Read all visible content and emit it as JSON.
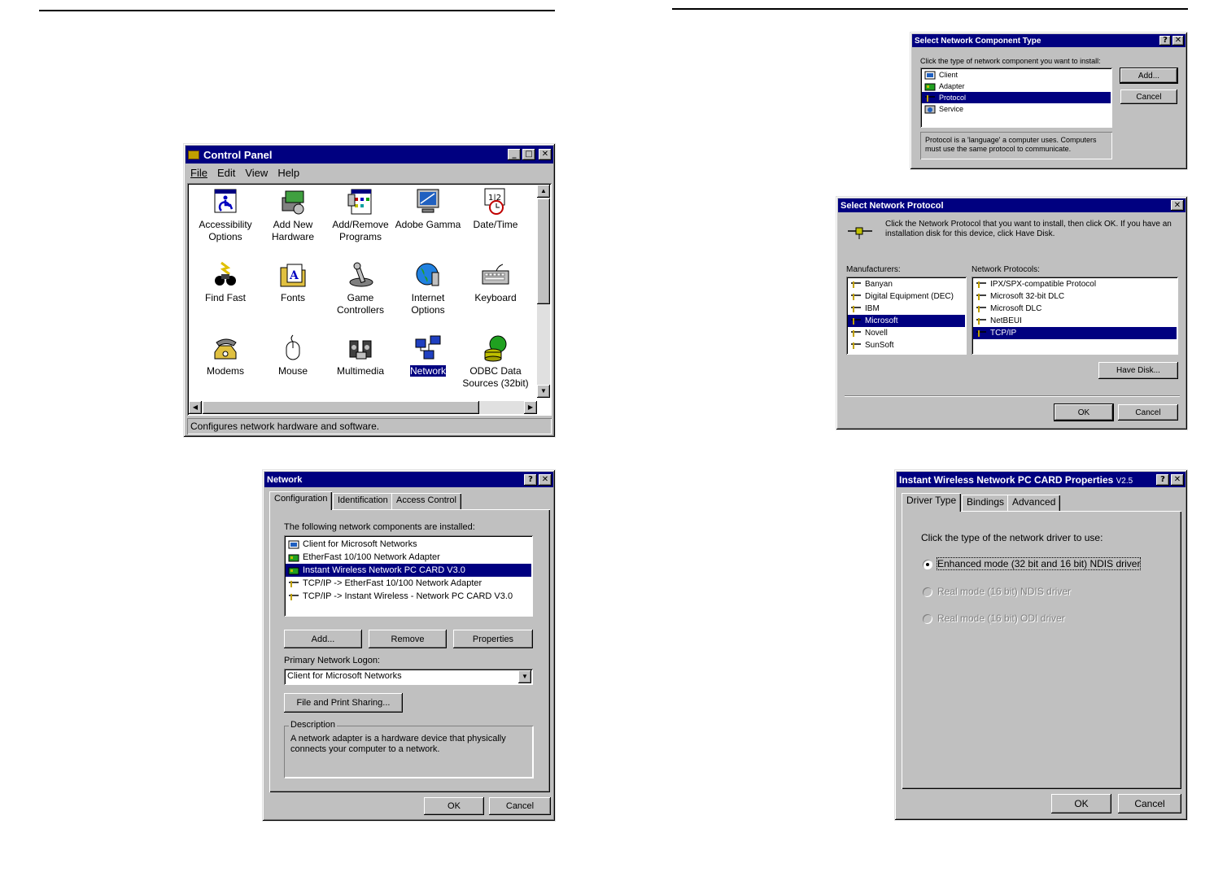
{
  "control_panel": {
    "title": "Control Panel",
    "menu": [
      "File",
      "Edit",
      "View",
      "Help"
    ],
    "items": [
      {
        "label": "Accessibility Options",
        "icon": "accessibility-icon"
      },
      {
        "label": "Add New Hardware",
        "icon": "add-hardware-icon"
      },
      {
        "label": "Add/Remove Programs",
        "icon": "add-remove-programs-icon"
      },
      {
        "label": "Adobe Gamma",
        "icon": "monitor-icon"
      },
      {
        "label": "Date/Time",
        "icon": "calendar-clock-icon"
      },
      {
        "label": "Find Fast",
        "icon": "binoculars-icon"
      },
      {
        "label": "Fonts",
        "icon": "fonts-folder-icon"
      },
      {
        "label": "Game Controllers",
        "icon": "joystick-icon"
      },
      {
        "label": "Internet Options",
        "icon": "globe-icon"
      },
      {
        "label": "Keyboard",
        "icon": "keyboard-icon"
      },
      {
        "label": "Modems",
        "icon": "phone-icon"
      },
      {
        "label": "Mouse",
        "icon": "mouse-icon"
      },
      {
        "label": "Multimedia",
        "icon": "speakers-icon"
      },
      {
        "label": "Network",
        "icon": "network-icon"
      },
      {
        "label": "ODBC Data Sources (32bit)",
        "icon": "database-icon"
      }
    ],
    "selected": "Network",
    "status": "Configures network hardware and software."
  },
  "component_type": {
    "title": "Select Network Component Type",
    "prompt": "Click the type of network component you want to install:",
    "items": [
      "Client",
      "Adapter",
      "Protocol",
      "Service"
    ],
    "selected": "Protocol",
    "add_label": "Add...",
    "cancel_label": "Cancel",
    "description": "Protocol is a 'language' a computer uses. Computers must use the same protocol to communicate."
  },
  "protocol_dialog": {
    "title": "Select Network Protocol",
    "instructions": "Click the Network Protocol that you want to install, then click OK. If you have an installation disk for this device, click Have Disk.",
    "manufacturers_label": "Manufacturers:",
    "manufacturers": [
      "Banyan",
      "Digital Equipment (DEC)",
      "IBM",
      "Microsoft",
      "Novell",
      "SunSoft"
    ],
    "manufacturer_selected": "Microsoft",
    "protocols_label": "Network Protocols:",
    "protocols": [
      "IPX/SPX-compatible Protocol",
      "Microsoft 32-bit DLC",
      "Microsoft DLC",
      "NetBEUI",
      "TCP/IP"
    ],
    "protocol_selected": "TCP/IP",
    "have_disk_label": "Have Disk...",
    "ok_label": "OK",
    "cancel_label": "Cancel"
  },
  "network_dialog": {
    "title": "Network",
    "tabs": [
      "Configuration",
      "Identification",
      "Access Control"
    ],
    "components_label": "The following network components are installed:",
    "components": [
      {
        "label": "Client for Microsoft Networks",
        "icon": "client-icon"
      },
      {
        "label": "EtherFast 10/100 Network Adapter",
        "icon": "adapter-icon"
      },
      {
        "label": "Instant Wireless Network PC CARD V3.0",
        "icon": "adapter-icon"
      },
      {
        "label": "TCP/IP -> EtherFast 10/100 Network Adapter",
        "icon": "protocol-icon"
      },
      {
        "label": "TCP/IP -> Instant Wireless - Network PC CARD V3.0",
        "icon": "protocol-icon"
      }
    ],
    "selected_index": 2,
    "add_label": "Add...",
    "remove_label": "Remove",
    "properties_label": "Properties",
    "logon_label": "Primary Network Logon:",
    "logon_value": "Client for Microsoft Networks",
    "sharing_label": "File and Print Sharing...",
    "description_label": "Description",
    "description_text": "A network adapter is a hardware device that physically connects your computer to a network.",
    "ok_label": "OK",
    "cancel_label": "Cancel"
  },
  "pc_card_dialog": {
    "title": "Instant Wireless Network PC CARD Properties",
    "title_version": "V2.5",
    "tabs": [
      "Driver Type",
      "Bindings",
      "Advanced"
    ],
    "prompt": "Click the type of the network driver to use:",
    "options": [
      {
        "label": "Enhanced mode (32 bit and 16 bit) NDIS driver",
        "checked": true,
        "enabled": true
      },
      {
        "label": "Real mode (16 bit) NDIS driver",
        "checked": false,
        "enabled": false
      },
      {
        "label": "Real mode (16 bit) ODI driver",
        "checked": false,
        "enabled": false
      }
    ],
    "ok_label": "OK",
    "cancel_label": "Cancel"
  },
  "colors": {
    "titlebar": "#000080",
    "face": "#c0c0c0",
    "selection": "#000080"
  }
}
